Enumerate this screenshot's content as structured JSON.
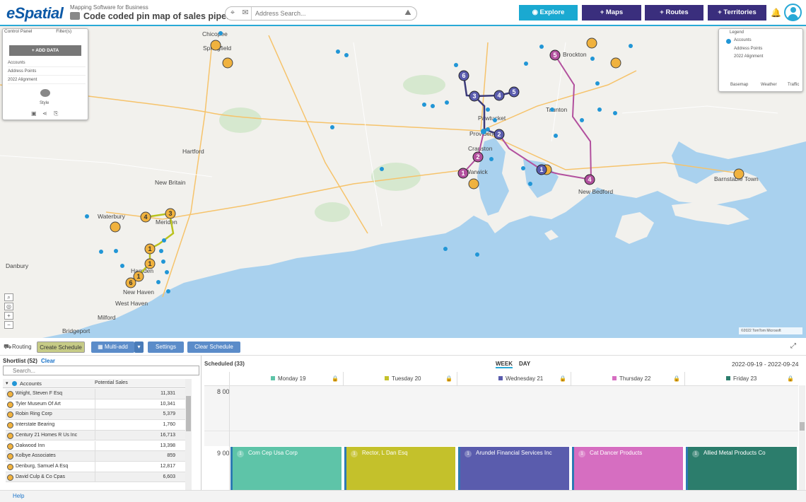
{
  "header": {
    "logo": "eSpatial",
    "subtitle": "Mapping Software for Business",
    "map_title": "Code coded pin map of sales pipel...",
    "search_placeholder": "Address Search...",
    "explore": "Explore",
    "maps": "+ Maps",
    "routes": "+ Routes",
    "territories": "+ Territories"
  },
  "control_panel": {
    "tab_control": "Control Panel",
    "tab_filters": "Filter(s)",
    "add_data": "ADD DATA",
    "layers": [
      "Accounts",
      "Address Points",
      "2022 Alignment"
    ],
    "style": "Style"
  },
  "legend": {
    "title": "Legend",
    "items": [
      "Accounts",
      "Address Points",
      "2022 Alignment"
    ],
    "footer": [
      "Basemap",
      "Weather",
      "Traffic"
    ]
  },
  "map": {
    "cities": [
      "Springfield",
      "Hartford",
      "New Britain",
      "Waterbury",
      "Meriden",
      "Hamden",
      "New Haven",
      "West Haven",
      "Milford",
      "Bridgeport",
      "Danbury",
      "Brockton",
      "Taunton",
      "Pawtucket",
      "Providence",
      "Cranston",
      "Warwick",
      "New Bedford",
      "Barnstable Town",
      "Chicopee"
    ],
    "copyright": "©2022 TomTom  Microsoft",
    "colors": {
      "yellow_route": "#b9c21d",
      "blue_route": "#3c3b7a",
      "pink_route": "#b2509e",
      "marker": "#f0b23e",
      "water": "#a9d1ee",
      "land": "#f2f1ed"
    }
  },
  "routing_bar": {
    "label": "Routing",
    "create_schedule": "Create Schedule",
    "multi_add": "Multi-add",
    "settings": "Settings",
    "clear_schedule": "Clear Schedule"
  },
  "shortlist": {
    "title": "Shortlist (52)",
    "clear": "Clear",
    "search_placeholder": "Search...",
    "col_accounts": "Accounts",
    "col_sales": "Potential Sales",
    "rows": [
      {
        "name": "Wright, Steven F Esq",
        "value": "11,331"
      },
      {
        "name": "Tyler Museum Of Art",
        "value": "10,341"
      },
      {
        "name": "Robin Ring Corp",
        "value": "5,379"
      },
      {
        "name": "Interstate Bearing",
        "value": "1,760"
      },
      {
        "name": "Century 21 Homes R Us Inc",
        "value": "16,713"
      },
      {
        "name": "Oakwood Inn",
        "value": "13,398"
      },
      {
        "name": "Kolbye Associates",
        "value": "859"
      },
      {
        "name": "Denburg, Samuel A Esq",
        "value": "12,817"
      },
      {
        "name": "David Culp & Co Cpas",
        "value": "6,603"
      }
    ]
  },
  "schedule": {
    "title": "Scheduled (33)",
    "week": "WEEK",
    "day": "DAY",
    "date_range": "2022-09-19 - 2022-09-24",
    "times": [
      "8 00",
      "9 00"
    ],
    "days": [
      {
        "label": "Monday 19",
        "color": "#5ec4a8"
      },
      {
        "label": "Tuesday 20",
        "color": "#c4c12b"
      },
      {
        "label": "Wednesday 21",
        "color": "#5a5cad"
      },
      {
        "label": "Thursday 22",
        "color": "#d66ec1"
      },
      {
        "label": "Friday 23",
        "color": "#2c7d6c"
      }
    ],
    "events": [
      {
        "num": "1",
        "label": "Com Cep Usa Corp"
      },
      {
        "num": "1",
        "label": "Rector, L Dan Esq"
      },
      {
        "num": "1",
        "label": "Arundel Financial Services Inc"
      },
      {
        "num": "1",
        "label": "Cat Dancer Products"
      },
      {
        "num": "1",
        "label": "Allied Metal Products Co"
      }
    ]
  },
  "footer": {
    "help": "Help"
  }
}
